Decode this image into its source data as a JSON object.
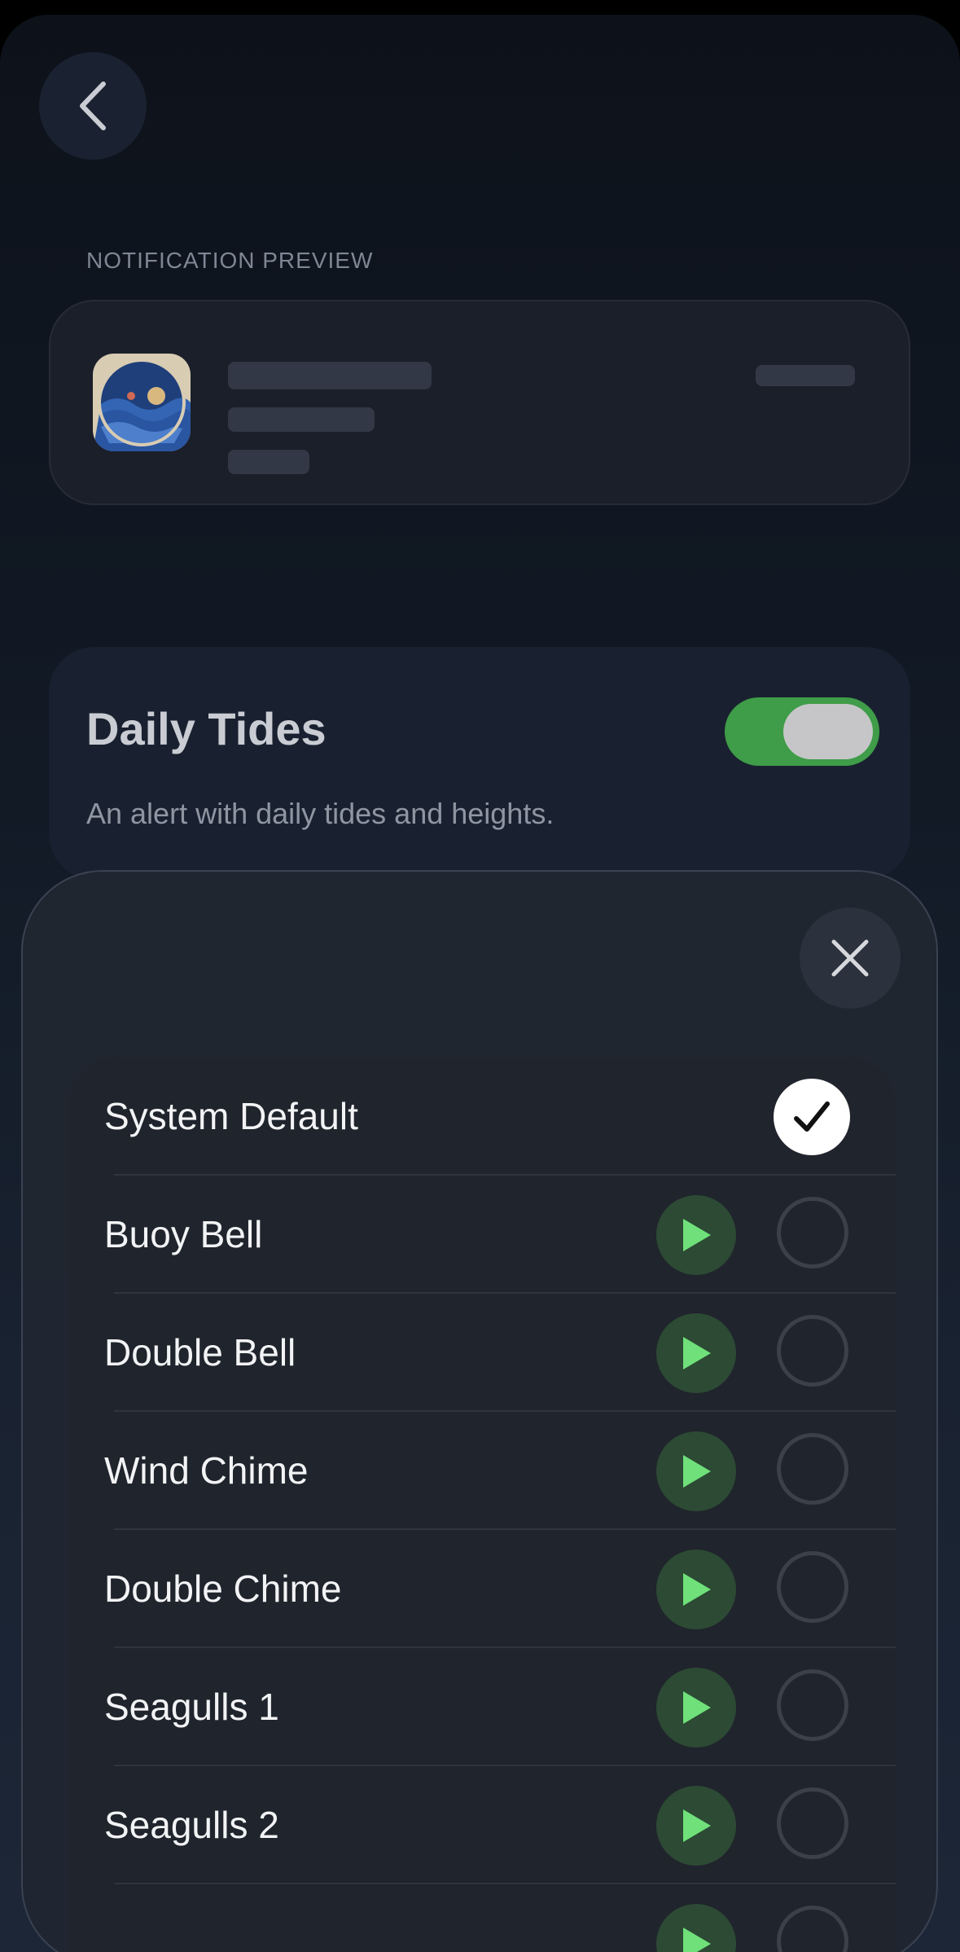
{
  "header": {
    "back_icon": "chevron-left-icon"
  },
  "preview": {
    "section_label": "NOTIFICATION PREVIEW",
    "app_icon": "tide-wave-app-icon"
  },
  "daily_tides": {
    "title": "Daily Tides",
    "description": "An alert with daily tides and heights.",
    "enabled": true,
    "toggle_color": "#3f9c48"
  },
  "sound_sheet": {
    "close_icon": "close-icon",
    "items": [
      {
        "label": "System Default",
        "selected": true,
        "playable": false
      },
      {
        "label": "Buoy Bell",
        "selected": false,
        "playable": true
      },
      {
        "label": "Double Bell",
        "selected": false,
        "playable": true
      },
      {
        "label": "Wind Chime",
        "selected": false,
        "playable": true
      },
      {
        "label": "Double Chime",
        "selected": false,
        "playable": true
      },
      {
        "label": "Seagulls 1",
        "selected": false,
        "playable": true
      },
      {
        "label": "Seagulls 2",
        "selected": false,
        "playable": true
      },
      {
        "label": "",
        "selected": false,
        "playable": true
      }
    ],
    "play_color": "#6fe07a"
  }
}
